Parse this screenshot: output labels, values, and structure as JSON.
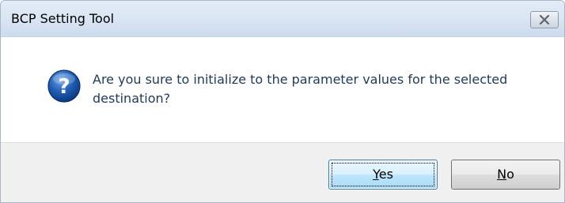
{
  "window": {
    "title": "BCP Setting Tool"
  },
  "icons": {
    "close": "close-icon",
    "message": "question-icon"
  },
  "colors": {
    "message_text": "#1e395b",
    "icon_blue": "#1f5fb6",
    "default_button_border": "#3c7fb1"
  },
  "dialog": {
    "message": "Are you sure to initialize to the parameter values for the selected destination?"
  },
  "buttons": {
    "yes": {
      "mnemonic": "Y",
      "rest": "es"
    },
    "no": {
      "mnemonic": "N",
      "rest": "o"
    }
  }
}
